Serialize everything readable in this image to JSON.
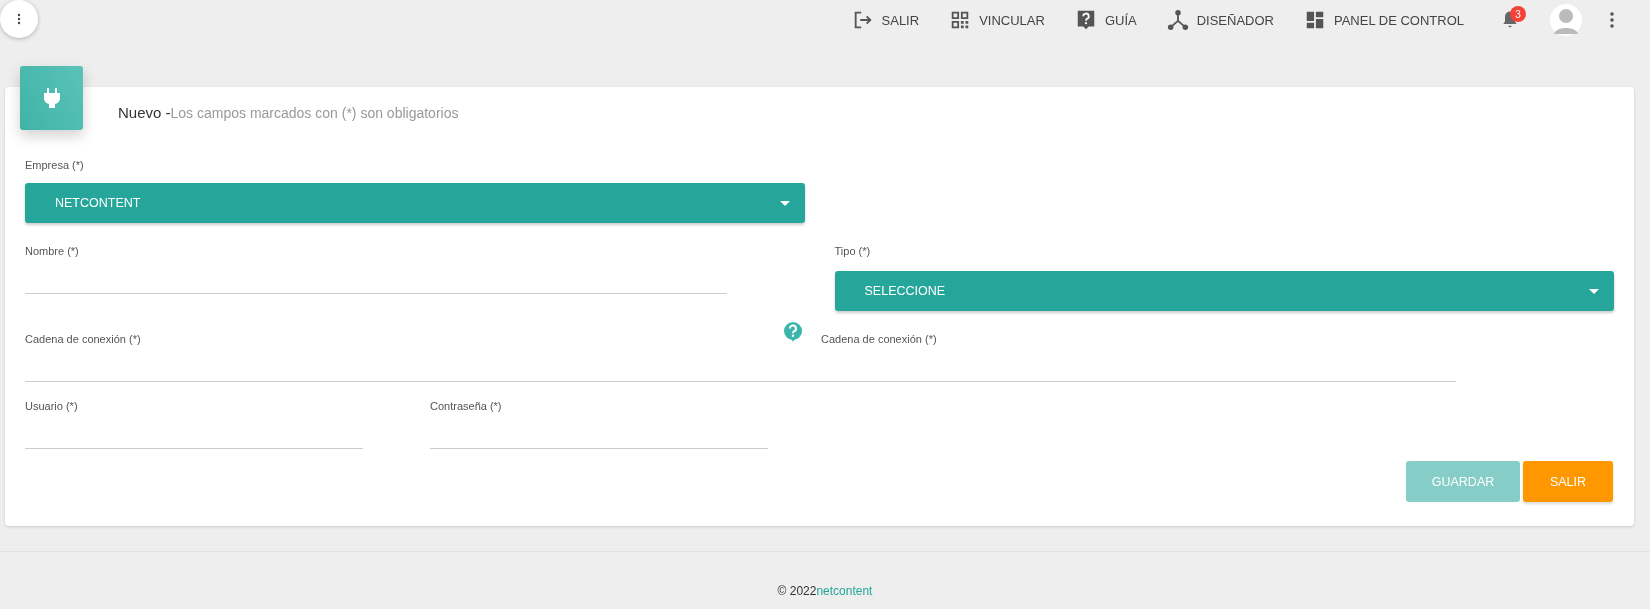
{
  "topbar": {
    "items": [
      {
        "kind": "exit",
        "label": "SALIR"
      },
      {
        "kind": "qr",
        "label": "VINCULAR"
      },
      {
        "kind": "help",
        "label": "GUÍA"
      },
      {
        "kind": "designer",
        "label": "DISEÑADOR"
      },
      {
        "kind": "dashboard",
        "label": "PANEL DE CONTROL"
      }
    ],
    "notification_count": "3"
  },
  "card": {
    "title": "Nuevo",
    "separator": "-",
    "subtitle": "Los campos marcados con (*) son obligatorios"
  },
  "form": {
    "empresa": {
      "label": "Empresa (*)",
      "value": "NETCONTENT"
    },
    "nombre": {
      "label": "Nombre (*)"
    },
    "tipo": {
      "label": "Tipo (*)",
      "value": "SELECCIONE"
    },
    "cadena": {
      "label": "Cadena de conexión (*)",
      "hint_label": "Cadena de conexión (*)"
    },
    "usuario": {
      "label": "Usuario (*)"
    },
    "contrasena": {
      "label": "Contraseña (*)"
    }
  },
  "buttons": [
    {
      "kind": "save",
      "label": "GUARDAR",
      "disabled": true
    },
    {
      "kind": "exit",
      "label": "SALIR",
      "disabled": false
    }
  ],
  "footer": {
    "copyright": "© 2022",
    "brand": "netcontent"
  }
}
